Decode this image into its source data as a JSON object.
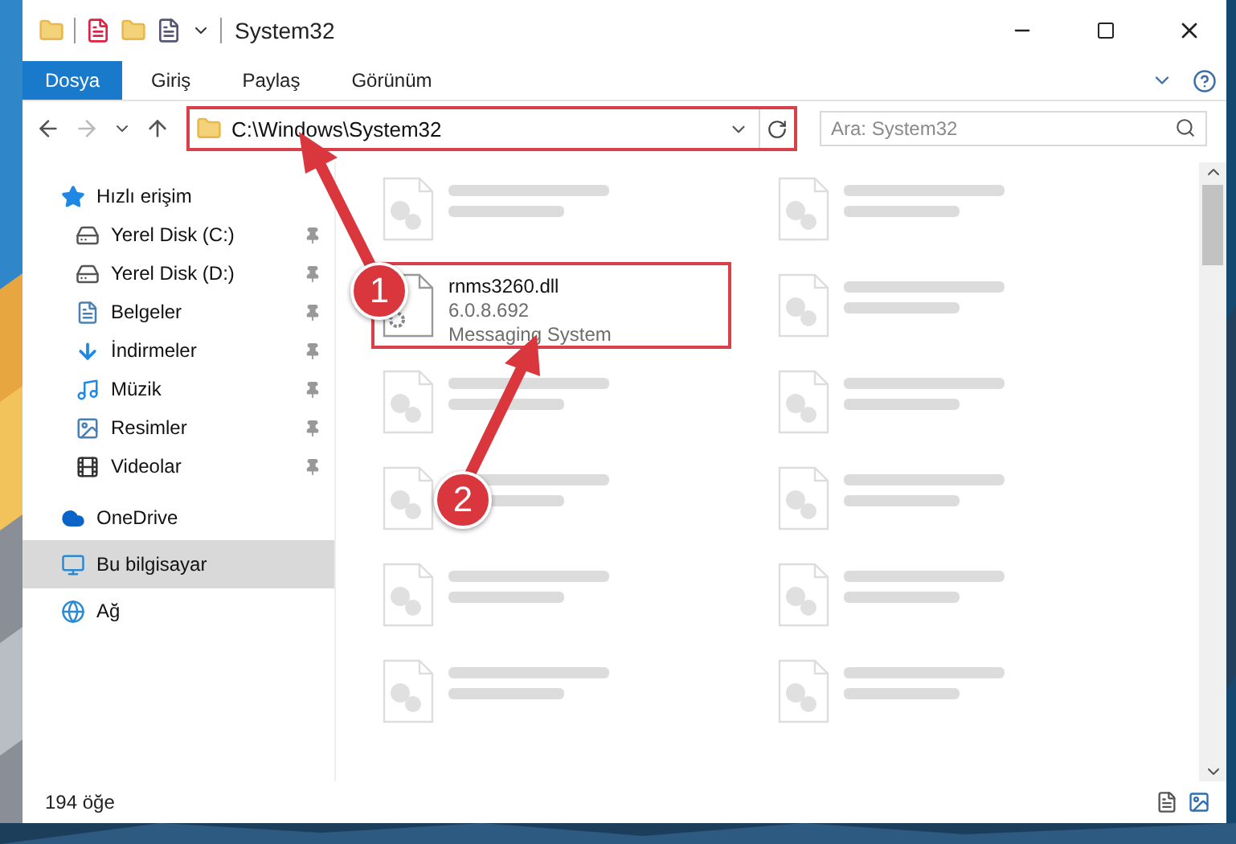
{
  "window": {
    "title": "System32"
  },
  "ribbon_tabs": [
    {
      "label": "Dosya",
      "selected": true
    },
    {
      "label": "Giriş",
      "selected": false
    },
    {
      "label": "Paylaş",
      "selected": false
    },
    {
      "label": "Görünüm",
      "selected": false
    }
  ],
  "address": {
    "path": "C:\\Windows\\System32",
    "highlighted": true
  },
  "search": {
    "placeholder": "Ara: System32"
  },
  "sidebar": {
    "items": [
      {
        "label": "Hızlı erişim",
        "kind": "quick",
        "selected": false,
        "children": [
          {
            "label": "Yerel Disk (C:)",
            "kind": "disk-c",
            "pinned": true,
            "selected": false
          },
          {
            "label": "Yerel Disk (D:)",
            "kind": "disk",
            "pinned": true,
            "selected": false
          },
          {
            "label": "Belgeler",
            "kind": "documents",
            "pinned": true,
            "selected": false
          },
          {
            "label": "İndirmeler",
            "kind": "downloads",
            "pinned": true,
            "selected": false
          },
          {
            "label": "Müzik",
            "kind": "music",
            "pinned": true,
            "selected": false
          },
          {
            "label": "Resimler",
            "kind": "pictures",
            "pinned": true,
            "selected": false
          },
          {
            "label": "Videolar",
            "kind": "videos",
            "pinned": true,
            "selected": false
          }
        ]
      },
      {
        "label": "OneDrive",
        "kind": "cloud",
        "selected": false
      },
      {
        "label": "Bu bilgisayar",
        "kind": "pc",
        "selected": true
      },
      {
        "label": "Ağ",
        "kind": "network",
        "selected": false
      }
    ]
  },
  "files": [
    {
      "kind": "blurred"
    },
    {
      "kind": "blurred"
    },
    {
      "kind": "file",
      "name": "rnms3260.dll",
      "version": "6.0.8.692",
      "type": "Messaging System",
      "highlighted": true
    },
    {
      "kind": "blurred"
    },
    {
      "kind": "blurred"
    },
    {
      "kind": "blurred"
    },
    {
      "kind": "blurred"
    },
    {
      "kind": "blurred"
    },
    {
      "kind": "blurred"
    },
    {
      "kind": "blurred"
    },
    {
      "kind": "blurred"
    },
    {
      "kind": "blurred"
    }
  ],
  "status_bar": {
    "count": "194 öğe"
  },
  "callouts": [
    {
      "number": "1"
    },
    {
      "number": "2"
    }
  ]
}
